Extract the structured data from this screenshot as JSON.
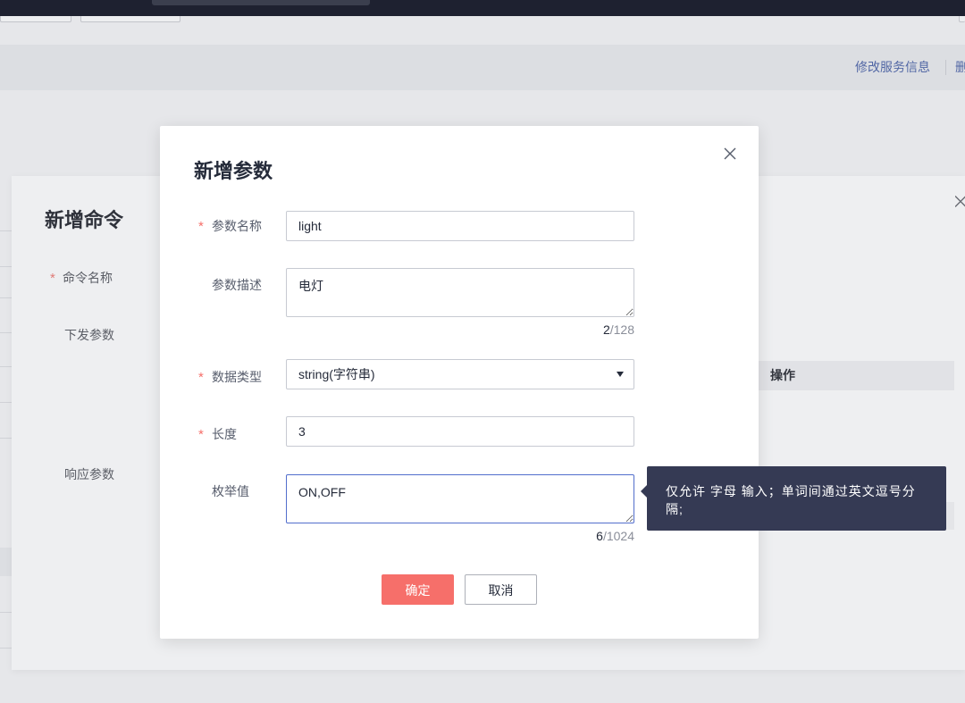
{
  "colors": {
    "header_bg": "#1e2130",
    "link": "#5368a5",
    "required_mark": "#f66f6a",
    "confirm_bg": "#f66f6a",
    "focus_border": "#526ecc",
    "tooltip_bg": "#353a54"
  },
  "icons": {
    "dialog_close": "close-icon",
    "select_caret": "caret-down-icon"
  },
  "page": {
    "service_actions": {
      "edit": "修改服务信息",
      "delete": "删"
    }
  },
  "command_dialog": {
    "title": "新增命令",
    "required_mark": "*",
    "command_name": {
      "label": "命令名称",
      "required": true
    },
    "request_params": {
      "label": "下发参数",
      "columns": [
        "操作"
      ]
    },
    "response_params": {
      "label": "响应参数"
    }
  },
  "param_dialog": {
    "title": "新增参数",
    "required_mark": "*",
    "counter_separator": "/",
    "param_name": {
      "label": "参数名称",
      "required": true,
      "value": "light"
    },
    "param_desc": {
      "label": "参数描述",
      "value": "电灯",
      "count": 2,
      "limit": 128
    },
    "data_type": {
      "label": "数据类型",
      "required": true,
      "value": "string(字符串)"
    },
    "length": {
      "label": "长度",
      "required": true,
      "value": "3"
    },
    "enum_values": {
      "label": "枚举值",
      "value": "ON,OFF",
      "focused": true,
      "count": 6,
      "limit": 1024,
      "tooltip": "仅允许 字母 输入；单词间通过英文逗号分隔;"
    },
    "confirm_label": "确定",
    "cancel_label": "取消"
  }
}
